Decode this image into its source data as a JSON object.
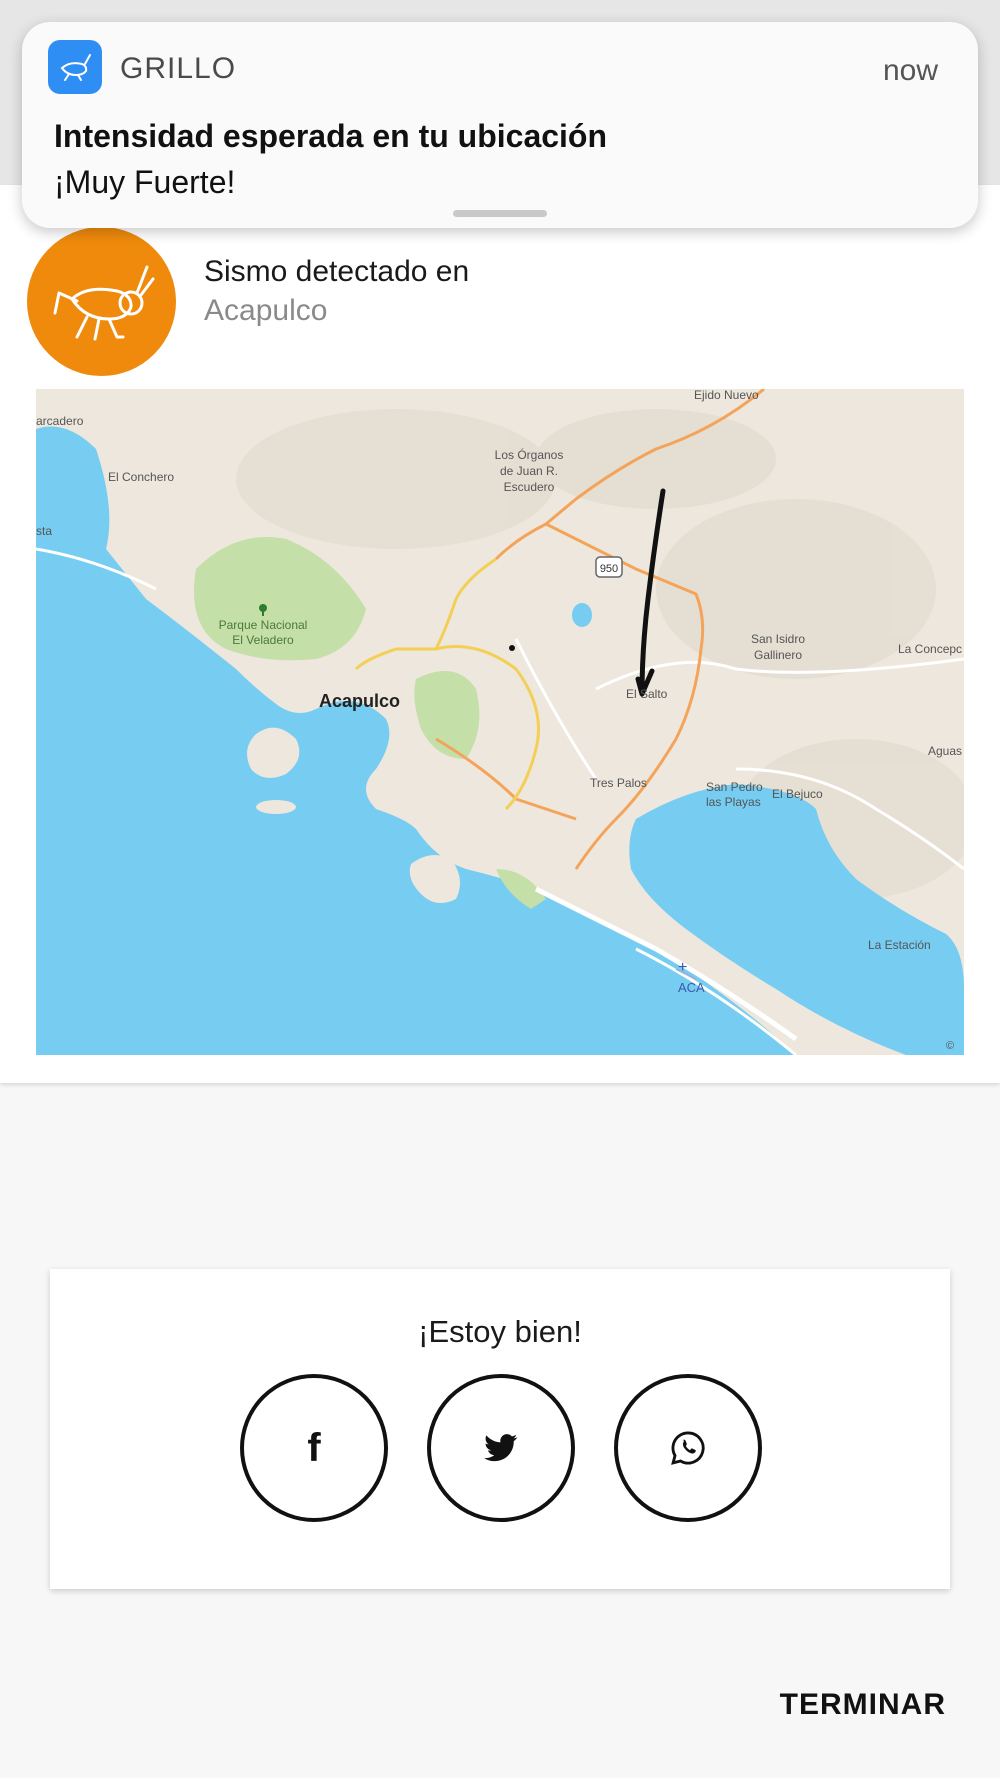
{
  "notification": {
    "app_name": "GRILLO",
    "time": "now",
    "title": "Intensidad esperada en tu ubicación",
    "body": "¡Muy Fuerte!"
  },
  "alert": {
    "title": "Sismo detectado en",
    "location": "Acapulco",
    "avatar_color": "#ef8a0c"
  },
  "map": {
    "labels": {
      "ejido_nuevo": "Ejido Nuevo",
      "arcadero": "arcadero",
      "el_conchero": "El Conchero",
      "los_organos_1": "Los Órganos",
      "los_organos_2": "de Juan R.",
      "los_organos_3": "Escudero",
      "sta": "sta",
      "highway": "950",
      "parque_1": "Parque Nacional",
      "parque_2": "El Veladero",
      "san_isidro_1": "San Isidro",
      "san_isidro_2": "Gallinero",
      "la_concepc": "La Concepc",
      "el_salto": "El Salto",
      "acapulco": "Acapulco",
      "aguas": "Aguas",
      "tres_palos": "Tres Palos",
      "san_pedro_1": "San Pedro",
      "san_pedro_2": "las Playas",
      "el_bejuco": "El Bejuco",
      "la_estacion": "La Estación",
      "aca": "ACA",
      "copyright": "© "
    },
    "water_color": "#76cdf1",
    "land_color": "#ede7dd",
    "park_color": "#c4dfa8"
  },
  "share": {
    "title": "¡Estoy bien!",
    "buttons": [
      {
        "icon": "facebook-icon",
        "label": "f"
      },
      {
        "icon": "twitter-icon"
      },
      {
        "icon": "whatsapp-icon"
      }
    ]
  },
  "footer": {
    "action_label": "TERMINAR"
  }
}
